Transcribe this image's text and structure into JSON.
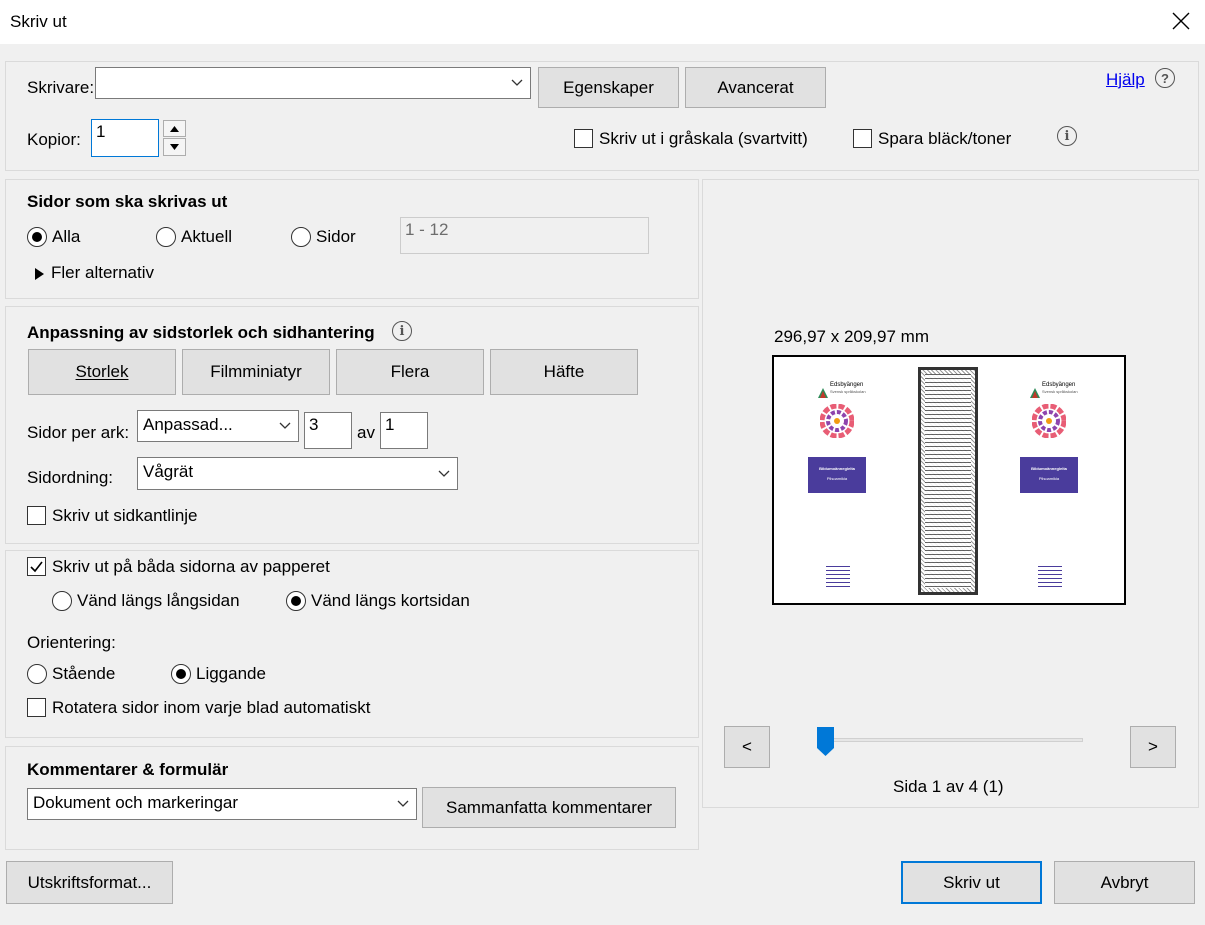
{
  "window": {
    "title": "Skriv ut"
  },
  "printer": {
    "label": "Skrivare:",
    "value": "",
    "properties_button": "Egenskaper",
    "advanced_button": "Avancerat",
    "help_link": "Hjälp"
  },
  "copies": {
    "label": "Kopior:",
    "value": "1"
  },
  "options": {
    "grayscale": "Skriv ut i gråskala (svartvitt)",
    "save_ink": "Spara bläck/toner",
    "grayscale_checked": false,
    "save_ink_checked": false
  },
  "pages": {
    "heading": "Sidor som ska skrivas ut",
    "all": "Alla",
    "current": "Aktuell",
    "pages": "Sidor",
    "range_placeholder": "1 - 12",
    "selected": "all",
    "more": "Fler alternativ"
  },
  "sizing": {
    "heading": "Anpassning av sidstorlek och sidhantering",
    "tabs": [
      "Storlek",
      "Filmminiatyr",
      "Flera",
      "Häfte"
    ],
    "pages_per_sheet_label": "Sidor per ark:",
    "pages_per_sheet_value": "Anpassad...",
    "cols": "3",
    "of": "av",
    "rows": "1",
    "page_order_label": "Sidordning:",
    "page_order_value": "Vågrät",
    "print_border": "Skriv ut sidkantlinje"
  },
  "duplex": {
    "both_sides": "Skriv ut på båda sidorna av papperet",
    "both_sides_checked": true,
    "long_edge": "Vänd längs långsidan",
    "short_edge": "Vänd längs kortsidan",
    "selected": "short",
    "orientation_label": "Orientering:",
    "portrait": "Stående",
    "landscape": "Liggande",
    "orientation_selected": "landscape",
    "auto_rotate": "Rotatera sidor inom varje blad automatiskt"
  },
  "comments": {
    "heading": "Kommentarer & formulär",
    "value": "Dokument och markeringar",
    "summarize_button": "Sammanfatta kommentarer"
  },
  "preview": {
    "dimensions": "296,97 x 209,97 mm",
    "prev": "<",
    "next": ">",
    "page_indicator": "Sida 1 av 4 (1)",
    "slider_position": 0,
    "thumb_logo": "Edsbyängen",
    "thumb_logo_sub": "Svensk språkskolan",
    "thumb_box_title": "Bildumoänneglelta",
    "thumb_box_sub": "Pilsoamikia",
    "accent_purple": "#4a3c9c"
  },
  "footer": {
    "page_setup": "Utskriftsformat...",
    "print": "Skriv ut",
    "cancel": "Avbryt"
  },
  "colors": {
    "accent": "#0078d7"
  }
}
